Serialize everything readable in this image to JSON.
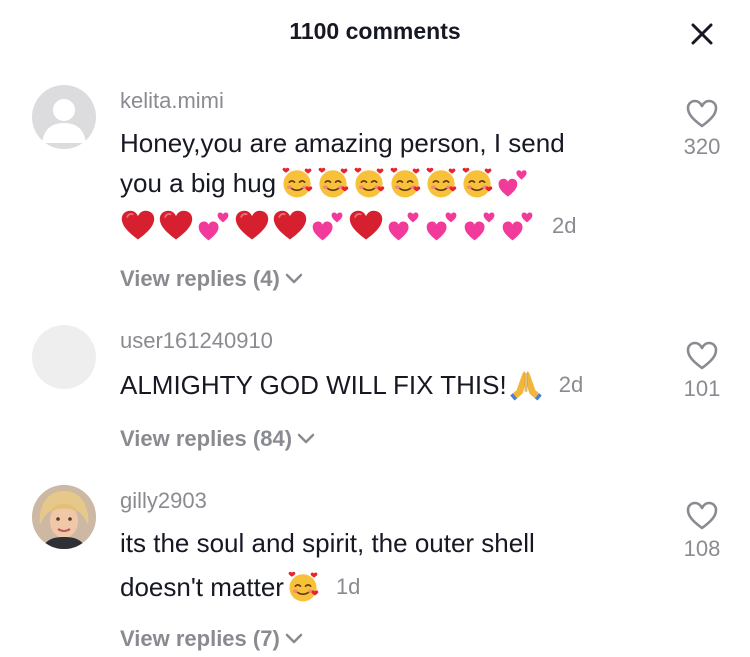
{
  "header": {
    "title": "1100 comments",
    "close_icon": "close-icon"
  },
  "comments": [
    {
      "username": "kelita.mimi",
      "line1": "Honey,you are amazing person, I send",
      "line2": "you a big hug",
      "time": "2d",
      "likes": "320",
      "replies": "View replies (4)",
      "emojis": {
        "line2": [
          "smiling-face-with-hearts",
          "smiling-face-with-hearts",
          "smiling-face-with-hearts",
          "smiling-face-with-hearts",
          "smiling-face-with-hearts",
          "smiling-face-with-hearts",
          "two-hearts"
        ],
        "line3": [
          "red-heart",
          "red-heart",
          "two-hearts",
          "red-heart",
          "red-heart",
          "two-hearts",
          "red-heart",
          "two-hearts",
          "two-hearts",
          "two-hearts",
          "two-hearts"
        ]
      }
    },
    {
      "username": "user161240910",
      "line1": "ALMIGHTY GOD WILL FIX THIS!",
      "time": "2d",
      "likes": "101",
      "replies": "View replies (84)",
      "emojis": {
        "line1": [
          "folded-hands"
        ]
      }
    },
    {
      "username": "gilly2903",
      "line1": "its the soul and spirit, the outer shell",
      "line2": "doesn't matter",
      "time": "1d",
      "likes": "108",
      "replies": "View replies (7)",
      "emojis": {
        "line2": [
          "smiling-face-with-hearts"
        ]
      }
    }
  ]
}
